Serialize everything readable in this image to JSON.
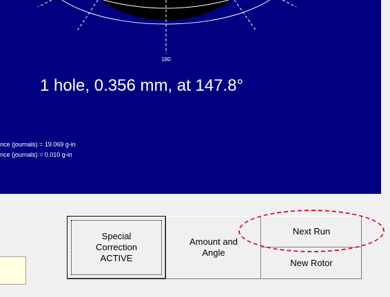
{
  "polar_plot": {
    "angle_label": "180"
  },
  "result_text": "1 hole, 0.356 mm, at 147.8°",
  "imbalance_lines": [
    "nce (journals) = 19.069 g-in",
    "nce (journals)  = 0.010 g-in"
  ],
  "buttons": {
    "special_correction": "Special\nCorrection\nACTIVE",
    "amount_and_angle": "Amount and\nAngle",
    "next_run": "Next Run",
    "new_rotor": "New Rotor"
  },
  "input_field": {
    "value": ""
  },
  "colors": {
    "panel_background": "#000080",
    "highlight": "#e0102a",
    "input_background": "#ffffe0"
  }
}
